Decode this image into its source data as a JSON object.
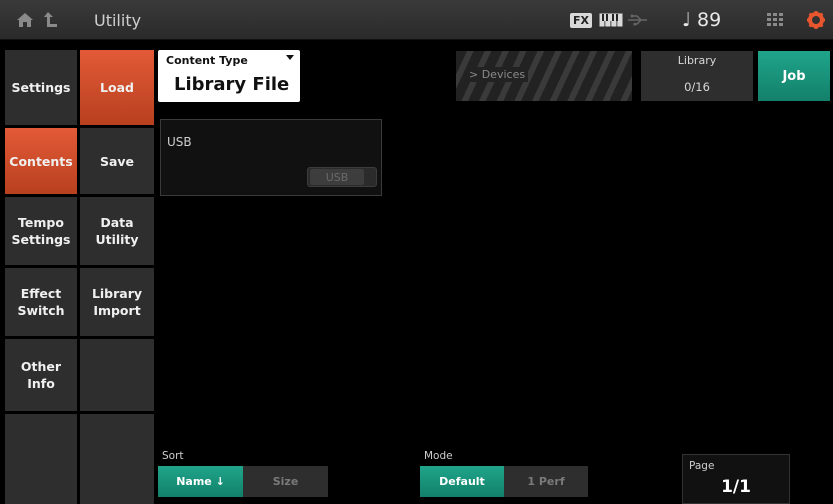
{
  "header": {
    "title": "Utility",
    "fx_label": "FX",
    "tempo": "♩ 89",
    "icons": [
      "home-icon",
      "back-icon",
      "keyboard-icon",
      "usb-icon",
      "grid-icon",
      "gear-icon"
    ]
  },
  "menu": {
    "primary": [
      {
        "label": "Settings",
        "selected": false
      },
      {
        "label": "Contents",
        "selected": true
      },
      {
        "label": "Tempo\nSettings",
        "selected": false
      },
      {
        "label": "Effect\nSwitch",
        "selected": false
      },
      {
        "label": "Other\nInfo",
        "selected": false
      },
      {
        "label": "",
        "selected": false
      }
    ],
    "secondary": [
      {
        "label": "Load",
        "selected": true
      },
      {
        "label": "Save",
        "selected": false
      },
      {
        "label": "Data\nUtility",
        "selected": false
      },
      {
        "label": "Library\nImport",
        "selected": false
      },
      {
        "label": "",
        "selected": false
      },
      {
        "label": "",
        "selected": false
      }
    ]
  },
  "content_type": {
    "label": "Content Type",
    "value": "Library File"
  },
  "devices": {
    "label": "> Devices"
  },
  "library": {
    "label": "Library",
    "value": "0/16"
  },
  "job": {
    "label": "Job"
  },
  "usb": {
    "label": "USB",
    "toggle_label": "USB"
  },
  "sort": {
    "label": "Sort",
    "options": [
      "Name ↓",
      "Size"
    ],
    "selected": 0
  },
  "mode": {
    "label": "Mode",
    "options": [
      "Default",
      "1 Perf"
    ],
    "selected": 0
  },
  "page": {
    "label": "Page",
    "value": "1/1"
  },
  "colors": {
    "accent_orange": "#d9512c",
    "accent_teal": "#1a9a80"
  }
}
